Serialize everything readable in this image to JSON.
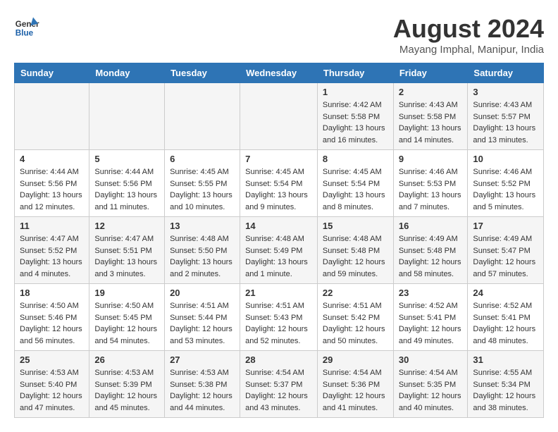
{
  "header": {
    "logo_line1": "General",
    "logo_line2": "Blue",
    "month_title": "August 2024",
    "location": "Mayang Imphal, Manipur, India"
  },
  "days_of_week": [
    "Sunday",
    "Monday",
    "Tuesday",
    "Wednesday",
    "Thursday",
    "Friday",
    "Saturday"
  ],
  "weeks": [
    [
      {
        "day": "",
        "info": ""
      },
      {
        "day": "",
        "info": ""
      },
      {
        "day": "",
        "info": ""
      },
      {
        "day": "",
        "info": ""
      },
      {
        "day": "1",
        "info": "Sunrise: 4:42 AM\nSunset: 5:58 PM\nDaylight: 13 hours and 16 minutes."
      },
      {
        "day": "2",
        "info": "Sunrise: 4:43 AM\nSunset: 5:58 PM\nDaylight: 13 hours and 14 minutes."
      },
      {
        "day": "3",
        "info": "Sunrise: 4:43 AM\nSunset: 5:57 PM\nDaylight: 13 hours and 13 minutes."
      }
    ],
    [
      {
        "day": "4",
        "info": "Sunrise: 4:44 AM\nSunset: 5:56 PM\nDaylight: 13 hours and 12 minutes."
      },
      {
        "day": "5",
        "info": "Sunrise: 4:44 AM\nSunset: 5:56 PM\nDaylight: 13 hours and 11 minutes."
      },
      {
        "day": "6",
        "info": "Sunrise: 4:45 AM\nSunset: 5:55 PM\nDaylight: 13 hours and 10 minutes."
      },
      {
        "day": "7",
        "info": "Sunrise: 4:45 AM\nSunset: 5:54 PM\nDaylight: 13 hours and 9 minutes."
      },
      {
        "day": "8",
        "info": "Sunrise: 4:45 AM\nSunset: 5:54 PM\nDaylight: 13 hours and 8 minutes."
      },
      {
        "day": "9",
        "info": "Sunrise: 4:46 AM\nSunset: 5:53 PM\nDaylight: 13 hours and 7 minutes."
      },
      {
        "day": "10",
        "info": "Sunrise: 4:46 AM\nSunset: 5:52 PM\nDaylight: 13 hours and 5 minutes."
      }
    ],
    [
      {
        "day": "11",
        "info": "Sunrise: 4:47 AM\nSunset: 5:52 PM\nDaylight: 13 hours and 4 minutes."
      },
      {
        "day": "12",
        "info": "Sunrise: 4:47 AM\nSunset: 5:51 PM\nDaylight: 13 hours and 3 minutes."
      },
      {
        "day": "13",
        "info": "Sunrise: 4:48 AM\nSunset: 5:50 PM\nDaylight: 13 hours and 2 minutes."
      },
      {
        "day": "14",
        "info": "Sunrise: 4:48 AM\nSunset: 5:49 PM\nDaylight: 13 hours and 1 minute."
      },
      {
        "day": "15",
        "info": "Sunrise: 4:48 AM\nSunset: 5:48 PM\nDaylight: 12 hours and 59 minutes."
      },
      {
        "day": "16",
        "info": "Sunrise: 4:49 AM\nSunset: 5:48 PM\nDaylight: 12 hours and 58 minutes."
      },
      {
        "day": "17",
        "info": "Sunrise: 4:49 AM\nSunset: 5:47 PM\nDaylight: 12 hours and 57 minutes."
      }
    ],
    [
      {
        "day": "18",
        "info": "Sunrise: 4:50 AM\nSunset: 5:46 PM\nDaylight: 12 hours and 56 minutes."
      },
      {
        "day": "19",
        "info": "Sunrise: 4:50 AM\nSunset: 5:45 PM\nDaylight: 12 hours and 54 minutes."
      },
      {
        "day": "20",
        "info": "Sunrise: 4:51 AM\nSunset: 5:44 PM\nDaylight: 12 hours and 53 minutes."
      },
      {
        "day": "21",
        "info": "Sunrise: 4:51 AM\nSunset: 5:43 PM\nDaylight: 12 hours and 52 minutes."
      },
      {
        "day": "22",
        "info": "Sunrise: 4:51 AM\nSunset: 5:42 PM\nDaylight: 12 hours and 50 minutes."
      },
      {
        "day": "23",
        "info": "Sunrise: 4:52 AM\nSunset: 5:41 PM\nDaylight: 12 hours and 49 minutes."
      },
      {
        "day": "24",
        "info": "Sunrise: 4:52 AM\nSunset: 5:41 PM\nDaylight: 12 hours and 48 minutes."
      }
    ],
    [
      {
        "day": "25",
        "info": "Sunrise: 4:53 AM\nSunset: 5:40 PM\nDaylight: 12 hours and 47 minutes."
      },
      {
        "day": "26",
        "info": "Sunrise: 4:53 AM\nSunset: 5:39 PM\nDaylight: 12 hours and 45 minutes."
      },
      {
        "day": "27",
        "info": "Sunrise: 4:53 AM\nSunset: 5:38 PM\nDaylight: 12 hours and 44 minutes."
      },
      {
        "day": "28",
        "info": "Sunrise: 4:54 AM\nSunset: 5:37 PM\nDaylight: 12 hours and 43 minutes."
      },
      {
        "day": "29",
        "info": "Sunrise: 4:54 AM\nSunset: 5:36 PM\nDaylight: 12 hours and 41 minutes."
      },
      {
        "day": "30",
        "info": "Sunrise: 4:54 AM\nSunset: 5:35 PM\nDaylight: 12 hours and 40 minutes."
      },
      {
        "day": "31",
        "info": "Sunrise: 4:55 AM\nSunset: 5:34 PM\nDaylight: 12 hours and 38 minutes."
      }
    ]
  ]
}
